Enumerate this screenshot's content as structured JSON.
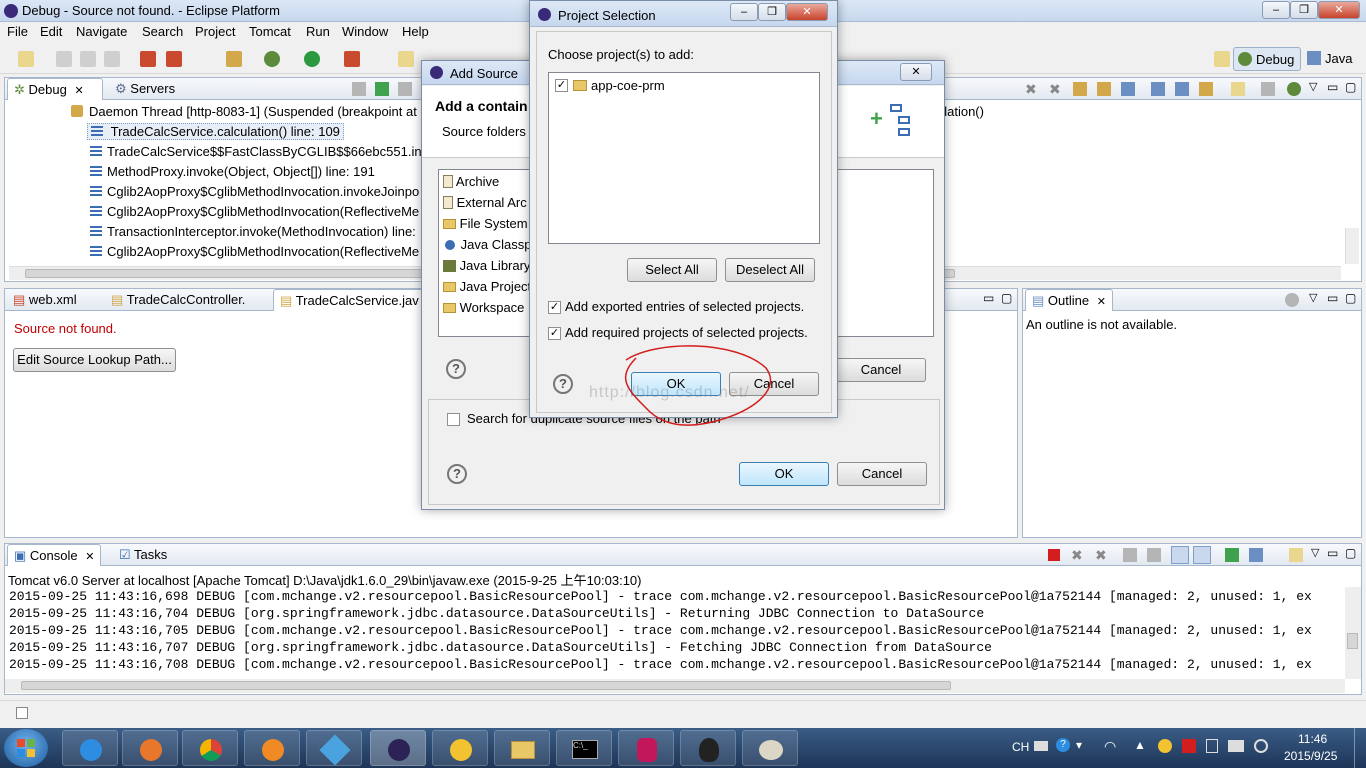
{
  "window": {
    "title": "Debug - Source not found. - Eclipse Platform"
  },
  "menu": [
    "File",
    "Edit",
    "Navigate",
    "Search",
    "Project",
    "Tomcat",
    "Run",
    "Window",
    "Help"
  ],
  "perspectives": {
    "debug": "Debug",
    "java": "Java"
  },
  "debug_view": {
    "tabs": [
      "Debug",
      "Servers"
    ],
    "thread": "Daemon Thread [http-8083-1] (Suspended (breakpoint at",
    "thread_suffix": "ulation()",
    "frames": [
      "TradeCalcService.calculation() line: 109",
      "TradeCalcService$$FastClassByCGLIB$$66ebc551.invok",
      "MethodProxy.invoke(Object, Object[]) line: 191",
      "Cglib2AopProxy$CglibMethodInvocation.invokeJoinpo",
      "Cglib2AopProxy$CglibMethodInvocation(ReflectiveMe",
      "TransactionInterceptor.invoke(MethodInvocation) line:",
      "Cglib2AopProxy$CglibMethodInvocation(ReflectiveMe"
    ]
  },
  "editor": {
    "tabs": [
      "web.xml",
      "TradeCalcController.",
      "TradeCalcService.jav"
    ],
    "message": "Source not found.",
    "edit_button": "Edit Source Lookup Path..."
  },
  "outline": {
    "tab": "Outline",
    "message": "An outline is not available."
  },
  "console": {
    "tabs": [
      "Console",
      "Tasks"
    ],
    "header": "Tomcat v6.0 Server at localhost [Apache Tomcat] D:\\Java\\jdk1.6.0_29\\bin\\javaw.exe (2015-9-25 上午10:03:10)",
    "lines": [
      "2015-09-25 11:43:16,698 DEBUG [com.mchange.v2.resourcepool.BasicResourcePool] - trace com.mchange.v2.resourcepool.BasicResourcePool@1a752144 [managed: 2, unused: 1, ex",
      "2015-09-25 11:43:16,704 DEBUG [org.springframework.jdbc.datasource.DataSourceUtils] - Returning JDBC Connection to DataSource",
      "2015-09-25 11:43:16,705 DEBUG [com.mchange.v2.resourcepool.BasicResourcePool] - trace com.mchange.v2.resourcepool.BasicResourcePool@1a752144 [managed: 2, unused: 1, ex",
      "2015-09-25 11:43:16,707 DEBUG [org.springframework.jdbc.datasource.DataSourceUtils] - Fetching JDBC Connection from DataSource",
      "2015-09-25 11:43:16,708 DEBUG [com.mchange.v2.resourcepool.BasicResourcePool] - trace com.mchange.v2.resourcepool.BasicResourcePool@1a752144 [managed: 2, unused: 1, ex"
    ]
  },
  "add_source": {
    "title": "Add Source",
    "heading": "Add a contain",
    "subheading": "Source folders",
    "items": [
      "Archive",
      "External Arc",
      "File System",
      "Java Classpa",
      "Java Library",
      "Java Project",
      "Workspace"
    ],
    "search_label": "Search for duplicate source files on the path",
    "ok": "OK",
    "cancel": "Cancel",
    "cancel_top": "Cancel"
  },
  "project_selection": {
    "title": "Project Selection",
    "prompt": "Choose project(s) to add:",
    "projects": [
      "app-coe-prm"
    ],
    "select_all": "Select All",
    "deselect_all": "Deselect All",
    "opt_exported": "Add exported entries of selected projects.",
    "opt_required": "Add required projects of selected projects.",
    "ok": "OK",
    "cancel": "Cancel",
    "watermark": "http://blog.csdn.net/"
  },
  "taskbar": {
    "lang": "CH",
    "time": "11:46",
    "date": "2015/9/25"
  }
}
